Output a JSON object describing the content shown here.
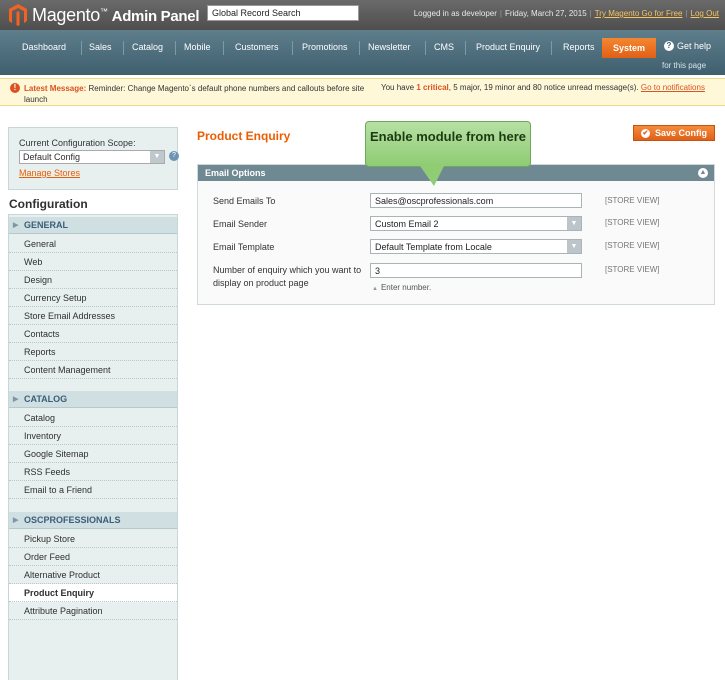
{
  "header": {
    "logo_text": "Magento",
    "logo_suffix": "Admin Panel",
    "search_value": "Global Record Search",
    "logged_in": "Logged in as developer",
    "date": "Friday, March 27, 2015",
    "try_link": "Try Magento Go for Free",
    "logout_link": "Log Out"
  },
  "nav": {
    "items": [
      "Dashboard",
      "Sales",
      "Catalog",
      "Mobile",
      "Customers",
      "Promotions",
      "Newsletter",
      "CMS",
      "Product Enquiry",
      "Reports"
    ],
    "active": "System",
    "help_line1": "Get help",
    "help_line2": "for this page"
  },
  "message": {
    "label": "Latest Message:",
    "text": "Reminder: Change Magento`s default phone numbers and callouts before site launch",
    "summary_prefix": "You have",
    "critical": "1 critical",
    "summary_mid": ", 5 major, 19 minor and 80 notice unread message(s).",
    "link": "Go to notifications"
  },
  "sidebar": {
    "scope_label": "Current Configuration Scope:",
    "scope_value": "Default Config",
    "manage_stores": "Manage Stores",
    "title": "Configuration",
    "groups": [
      {
        "name": "GENERAL",
        "items": [
          "General",
          "Web",
          "Design",
          "Currency Setup",
          "Store Email Addresses",
          "Contacts",
          "Reports",
          "Content Management"
        ]
      },
      {
        "name": "CATALOG",
        "items": [
          "Catalog",
          "Inventory",
          "Google Sitemap",
          "RSS Feeds",
          "Email to a Friend"
        ]
      },
      {
        "name": "OSCPROFESSIONALS",
        "items": [
          "Pickup Store",
          "Order Feed",
          "Alternative Product",
          "Product Enquiry",
          "Attribute Pagination"
        ]
      }
    ],
    "active_item": "Product Enquiry"
  },
  "main": {
    "title": "Product Enquiry",
    "save_label": "Save Config",
    "section_title": "Email Options",
    "callout": "Enable module from here",
    "rows": [
      {
        "label": "Send Emails To",
        "value": "Sales@oscprofessionals.com",
        "type": "text",
        "scope": "[STORE VIEW]"
      },
      {
        "label": "Email Sender",
        "value": "Custom Email 2",
        "type": "select",
        "scope": "[STORE VIEW]"
      },
      {
        "label": "Email Template",
        "value": "Default Template from Locale",
        "type": "select",
        "scope": "[STORE VIEW]"
      },
      {
        "label": "Number of enquiry which you want to display on product page",
        "value": "3",
        "type": "text",
        "scope": "[STORE VIEW]",
        "hint": "Enter number."
      }
    ]
  }
}
